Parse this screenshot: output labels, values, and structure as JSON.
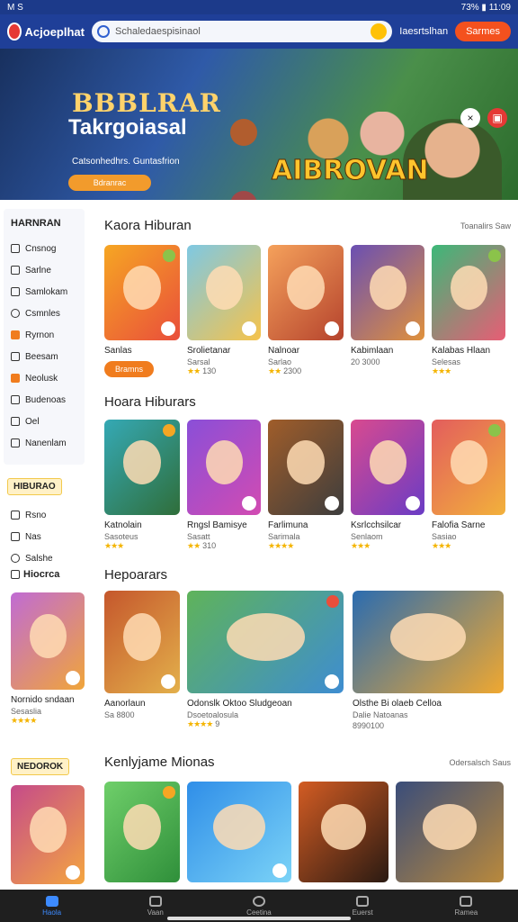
{
  "status": {
    "left": "M S",
    "right": "73% ▮ 11:09"
  },
  "header": {
    "logo_text": "Acjoeplhat",
    "search_placeholder": "Schaledaespisinaol",
    "link": "Iaesrtslhan",
    "signup": "Sarmes"
  },
  "hero": {
    "title1": "BBBLRAR",
    "title2": "Takrgoiasal",
    "subtitle": "Catsonhedhrs.  Guntasfrion",
    "cta": "Bdranrac",
    "brand": "AIBROVAN"
  },
  "sidebar": {
    "heading": "HARNRAN",
    "items": [
      "Cnsnog",
      "Sarlne",
      "Samlokam",
      "Csmnles",
      "Ryrnon",
      "Beesam",
      "Neolusk",
      "Budenoas",
      "Oel",
      "Nanenlam"
    ],
    "badge": "HIBURAO",
    "items2": [
      "Rsno",
      "Nas",
      "Salshe"
    ],
    "section3": "Hiocrca"
  },
  "sections": [
    {
      "title": "Kaora Hiburan",
      "more": "Toanalirs Saw",
      "cards": [
        {
          "name": "Sanlas",
          "meta": "",
          "rating": "",
          "play": "Bramns"
        },
        {
          "name": "Srolietanar",
          "meta": "Sarsal",
          "rating": "130"
        },
        {
          "name": "Nalnoar",
          "meta": "Sarlao",
          "rating": "2300"
        },
        {
          "name": "Kabimlaan",
          "meta": "20 3000",
          "rating": ""
        },
        {
          "name": "Kalabas Hlaan",
          "meta": "Selesas",
          "rating": ""
        }
      ]
    },
    {
      "title": "Hoara Hiburars",
      "more": "",
      "cards": [
        {
          "name": "Katnolain",
          "meta": "Sasoteus",
          "rating": ""
        },
        {
          "name": "Rngsl Bamisye",
          "meta": "Sasatt",
          "rating": "310"
        },
        {
          "name": "Farlimuna",
          "meta": "Sarimala",
          "rating": ""
        },
        {
          "name": "Ksrlcchsilcar",
          "meta": "Senlaom",
          "rating": ""
        },
        {
          "name": "Falofia Sarne",
          "meta": "Sasiao",
          "rating": ""
        }
      ]
    },
    {
      "title": "Hepoarars",
      "more": "",
      "cards": [
        {
          "name": "Nornido sndaan",
          "meta": "Sesaslia",
          "rating": ""
        },
        {
          "name": "Aanorlaun",
          "meta": "Sa 8800",
          "rating": ""
        },
        {
          "name": "Odonslk Oktoo Sludgeoan",
          "meta": "Dsoetoalosula",
          "rating": "9"
        },
        {
          "name": "Olsthe Bi olaeb Celloa",
          "meta": "Dalie Natoanas",
          "rating": "8990100"
        }
      ]
    },
    {
      "title": "Kenlyjame Mionas",
      "more": "Odersalsch Saus",
      "left_badge": "NEDOROK"
    }
  ],
  "nav": [
    "Haola",
    "Vaan",
    "Ceetina",
    "Euerst",
    "Ramea"
  ]
}
